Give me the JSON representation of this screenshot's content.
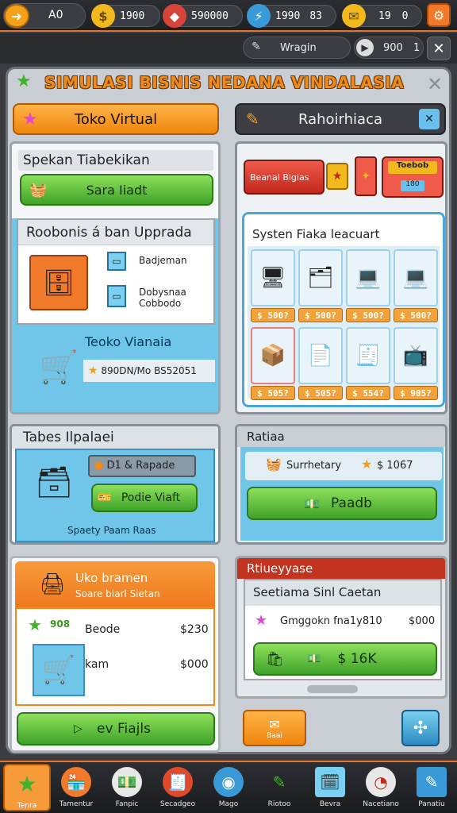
{
  "topbar": {
    "level_label": "A0",
    "res1": "1900",
    "res2": "590000",
    "res3": "1990",
    "res3b": "83",
    "res4": "19",
    "res4b": "0"
  },
  "subbar": {
    "search_value": "Wragin",
    "counter": "900",
    "counter_b": "1"
  },
  "title": "SIMULASI BISNIS NEDANA VINDALASIA",
  "tabs": {
    "left": "Toko Virtual",
    "right": "Rahoirhiaca"
  },
  "left_top": {
    "header": "Spekan Tiabekikan",
    "button": "Sara Iiadt",
    "upgrade_header": "Roobonis á ban Upprada",
    "upgrade_items": [
      "Badjeman",
      "Dobysnaa",
      "Cobbodo"
    ],
    "store_title": "Teoko Vianaia",
    "store_price": "890DN/Mo BS52051"
  },
  "right_top": {
    "red_button": "Beanal Bigias",
    "small_label": "Toebob",
    "small_label2": "180",
    "system_title": "Systen Fiaka leacuart",
    "prices_row1": [
      "$ 500?",
      "$ 500?",
      "$ 500?",
      "$ 500?"
    ],
    "prices_row2": [
      "$ 505?",
      "$ 505?",
      "$ 554?",
      "$ 905?"
    ]
  },
  "left_mid": {
    "header": "Tabes Ilpalaei",
    "label": "D1 & Rapade",
    "button": "Podie Viaft",
    "caption": "Spaety Paam Raas"
  },
  "right_mid": {
    "header": "Ratiaa",
    "label": "Surrhetary",
    "price": "$ 1067",
    "button": "Paadb"
  },
  "left_bottom": {
    "header": "Uko bramen",
    "subheader": "Soare biarl Sietan",
    "badge": "908",
    "row1_name": "Beode",
    "row1_value": "$230",
    "row2_name": "kam",
    "row2_value": "$000",
    "button": "ev Fiajls"
  },
  "right_bottom": {
    "header": "Rtiueyyase",
    "subheader": "Seetiama Sinl Caetan",
    "row_name": "Gmggokn fna1y810",
    "row_value": "$000",
    "button": "$ 16K",
    "orange_button": "Baai"
  },
  "nav": [
    "Tenra",
    "Tamentur",
    "Fanpic",
    "Secadgeo",
    "Mago",
    "Riotoo",
    "Bevra",
    "Nacetiano",
    "Panatiu"
  ],
  "colors": {
    "accent": "#e8742a",
    "green": "#4caf2f",
    "blue": "#6fc6e8",
    "orange": "#f5922a"
  }
}
